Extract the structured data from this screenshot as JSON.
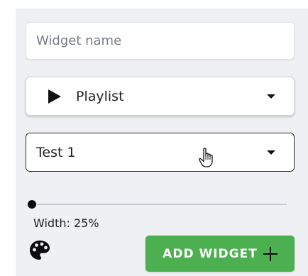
{
  "form": {
    "name_placeholder": "Widget name",
    "name_value": "",
    "type_select": {
      "icon": "play-icon",
      "selected": "Playlist"
    },
    "item_select": {
      "selected": "Test 1"
    },
    "width_slider": {
      "value_percent": 25,
      "label": "Width: 25%"
    },
    "palette_icon": "palette-icon",
    "add_button": {
      "label": "ADD WIDGET",
      "icon": "plus-icon",
      "color": "#4caf50"
    }
  }
}
